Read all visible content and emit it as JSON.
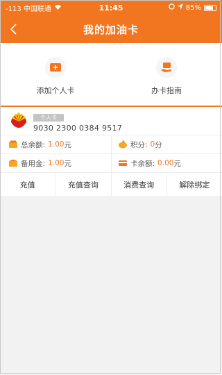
{
  "status_bar": {
    "signal": "-113 中国联通",
    "time": "11:45",
    "battery": "85%"
  },
  "nav": {
    "title": "我的加油卡"
  },
  "quick_actions": [
    {
      "label": "添加个人卡",
      "icon": "add-card-icon"
    },
    {
      "label": "办卡指南",
      "icon": "guide-icon"
    }
  ],
  "card": {
    "tag": "个人卡",
    "number": "9030 2300 0384 9517",
    "total_balance_label": "总余额:",
    "total_balance_value": "1.00",
    "points_label": "积分:",
    "points_value": "0",
    "points_unit": "分",
    "reserve_label": "备用金:",
    "reserve_value": "1.00",
    "card_balance_label": "卡余额:",
    "card_balance_value": "0.00",
    "currency_unit": "元"
  },
  "actions": [
    "充值",
    "充值查询",
    "消费查询",
    "解除绑定"
  ],
  "colors": {
    "accent": "#f2761f"
  }
}
